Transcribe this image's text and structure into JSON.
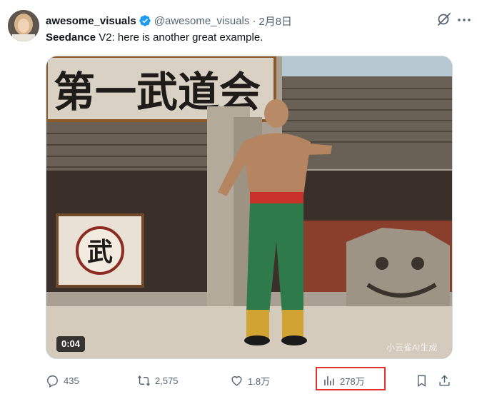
{
  "author": {
    "display_name": "awesome_visuals",
    "handle": "@awesome_visuals",
    "separator": "·",
    "date": "2月8日"
  },
  "tweet": {
    "bold_text": "Seedance",
    "text": " V2: here is another great example."
  },
  "media": {
    "timestamp": "0:04",
    "watermark": "小云雀AI生成",
    "sign_text": "第一武道会",
    "banner_char": "武"
  },
  "actions": {
    "replies": "435",
    "reposts": "2,575",
    "likes": "1.8万",
    "views": "278万"
  },
  "colors": {
    "verified": "#1d9bf0",
    "highlight_box": "#e0312c",
    "muted": "#536471"
  },
  "icons": [
    "verified-badge-icon",
    "grok-icon",
    "more-icon",
    "reply-icon",
    "repost-icon",
    "like-icon",
    "views-icon",
    "bookmark-icon",
    "share-icon"
  ]
}
